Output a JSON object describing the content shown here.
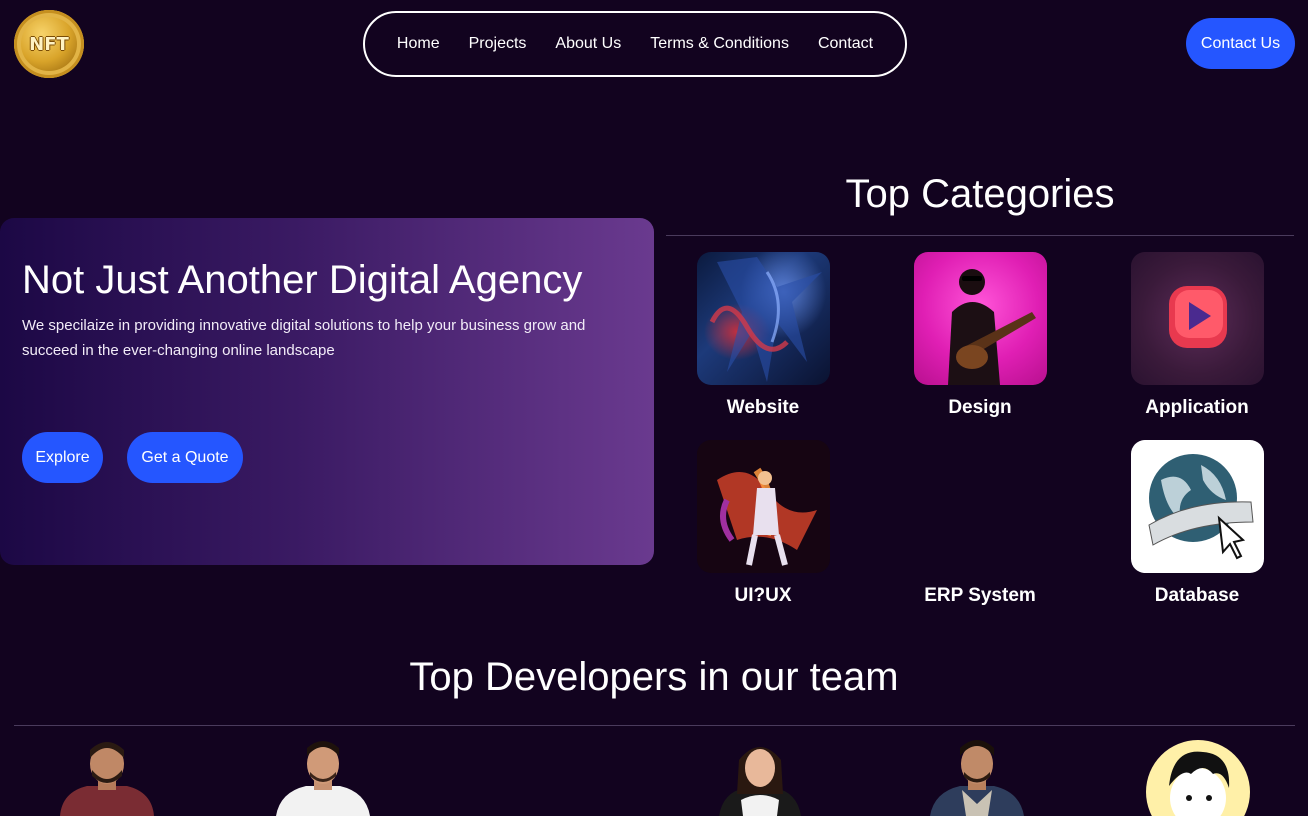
{
  "header": {
    "logo_text": "NFT",
    "nav": [
      "Home",
      "Projects",
      "About Us",
      "Terms & Conditions",
      "Contact"
    ],
    "contact_button": "Contact Us"
  },
  "hero": {
    "title": "Not Just Another Digital Agency",
    "description": "We specilaize in providing innovative digital solutions to help your business grow and succeed in the ever-changing online landscape",
    "explore_button": "Explore",
    "quote_button": "Get a Quote"
  },
  "categories": {
    "title": "Top Categories",
    "items": [
      "Website",
      "Design",
      "Application",
      "UI?UX",
      "ERP System",
      "Database"
    ]
  },
  "developers": {
    "title": "Top Developers in our team"
  },
  "colors": {
    "background": "#12031f",
    "accent": "#2556ff",
    "hero_gradient_start": "#1c0845",
    "hero_gradient_end": "#6a3a8f"
  }
}
